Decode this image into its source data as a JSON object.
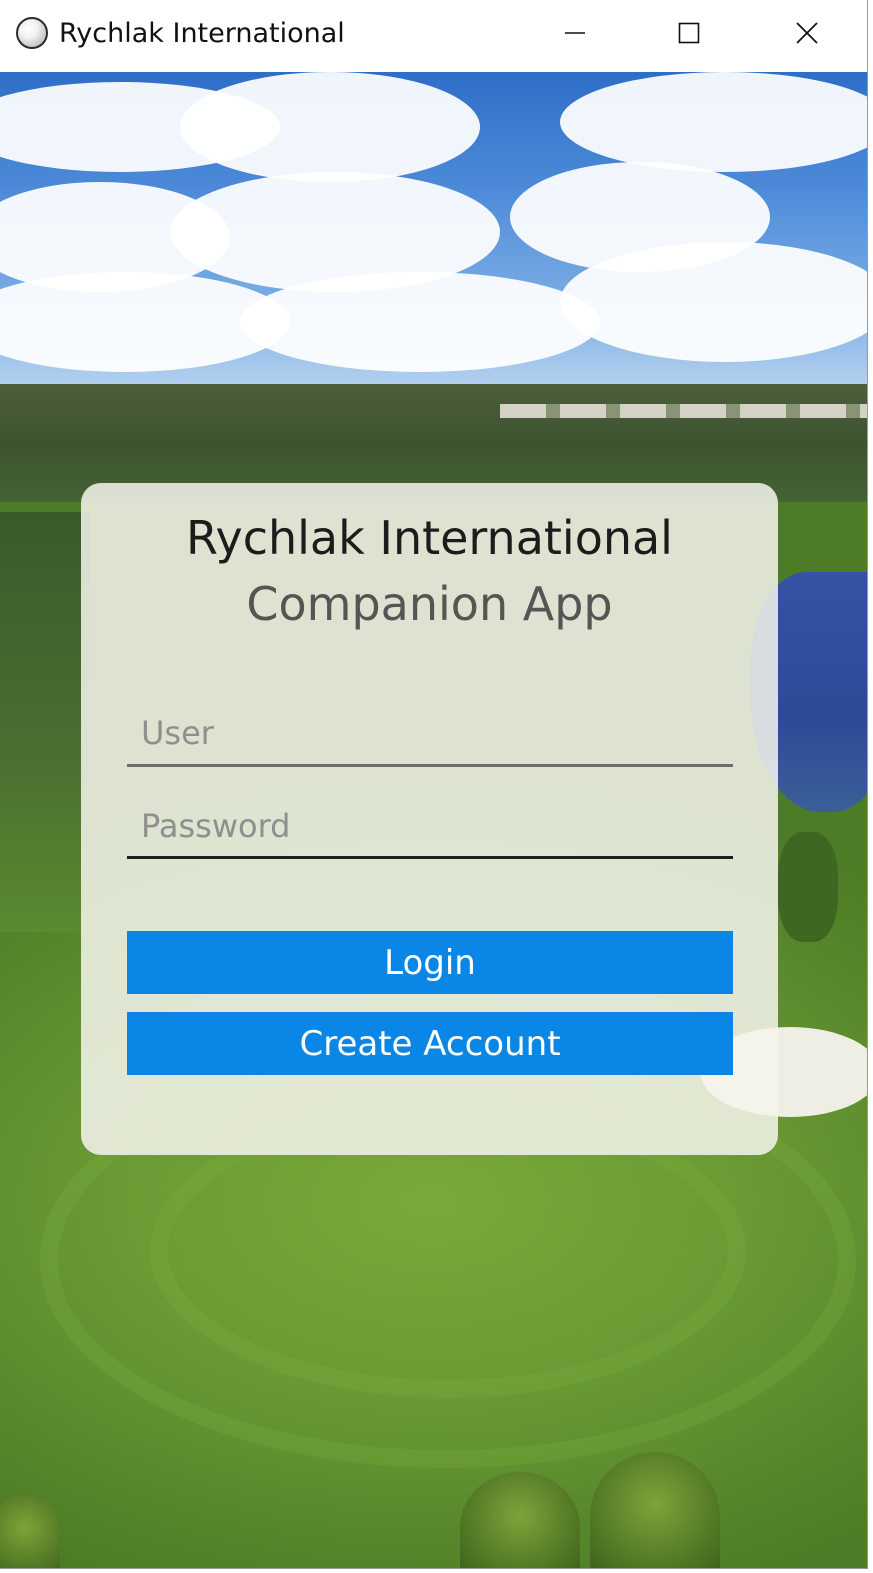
{
  "window": {
    "title": "Rychlak International",
    "icon": "golf-ball-icon",
    "controls": {
      "minimize": "minimize-icon",
      "maximize": "maximize-icon",
      "close": "close-icon"
    }
  },
  "login": {
    "title": "Rychlak International",
    "subtitle": "Companion App",
    "user_field": {
      "value": "",
      "placeholder": "User"
    },
    "password_field": {
      "value": "",
      "placeholder": "Password"
    },
    "login_label": "Login",
    "create_account_label": "Create Account"
  },
  "colors": {
    "button_accent": "#0a86e6",
    "button_text": "#ffffff",
    "card_background": "#f4f4ec"
  }
}
